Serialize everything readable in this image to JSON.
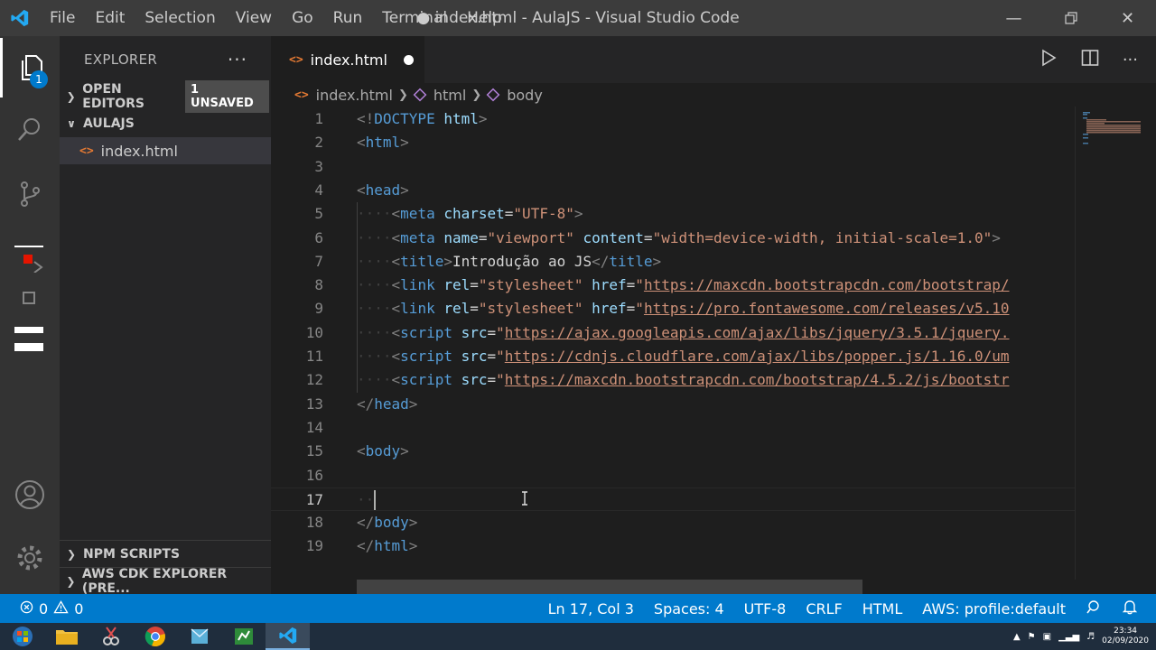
{
  "window": {
    "title": "● index.html - AulaJS - Visual Studio Code",
    "menu": [
      "File",
      "Edit",
      "Selection",
      "View",
      "Go",
      "Run",
      "Terminal",
      "Help"
    ]
  },
  "activity_bar": {
    "explorer_badge": "1",
    "icons": [
      "files-icon",
      "search-icon",
      "source-control-icon",
      "run-debug-icon",
      "extensions-icon",
      "accounts-icon",
      "gear-icon"
    ]
  },
  "sidebar": {
    "title": "EXPLORER",
    "more": "···",
    "open_editors": {
      "label": "OPEN EDITORS",
      "badge": "1 UNSAVED"
    },
    "folder": {
      "label": "AULAJS",
      "files": [
        "index.html"
      ]
    },
    "npm_scripts": "NPM SCRIPTS",
    "aws_cdk": "AWS CDK EXPLORER (PRE..."
  },
  "tabs": [
    {
      "label": "index.html",
      "dirty": true
    }
  ],
  "breadcrumb": [
    "index.html",
    "html",
    "body"
  ],
  "editor": {
    "current_line": 17,
    "line_numbers": [
      "1",
      "2",
      "3",
      "4",
      "5",
      "6",
      "7",
      "8",
      "9",
      "10",
      "11",
      "12",
      "13",
      "14",
      "15",
      "16",
      "17",
      "18",
      "19"
    ],
    "lines": [
      {
        "indent": "",
        "tokens": [
          [
            "br",
            "<!"
          ],
          [
            "tag",
            "DOCTYPE"
          ],
          [
            "tx",
            " "
          ],
          [
            "at",
            "html"
          ],
          [
            "br",
            ">"
          ]
        ]
      },
      {
        "indent": "",
        "tokens": [
          [
            "br",
            "<"
          ],
          [
            "tag",
            "html"
          ],
          [
            "br",
            ">"
          ]
        ]
      },
      {
        "indent": "",
        "tokens": []
      },
      {
        "indent": "",
        "tokens": [
          [
            "br",
            "<"
          ],
          [
            "tag",
            "head"
          ],
          [
            "br",
            ">"
          ]
        ]
      },
      {
        "indent": "····",
        "tokens": [
          [
            "br",
            "<"
          ],
          [
            "tag",
            "meta"
          ],
          [
            "tx",
            " "
          ],
          [
            "at",
            "charset"
          ],
          [
            "tx",
            "="
          ],
          [
            "st",
            "\"UTF-8\""
          ],
          [
            "br",
            ">"
          ]
        ]
      },
      {
        "indent": "····",
        "tokens": [
          [
            "br",
            "<"
          ],
          [
            "tag",
            "meta"
          ],
          [
            "tx",
            " "
          ],
          [
            "at",
            "name"
          ],
          [
            "tx",
            "="
          ],
          [
            "st",
            "\"viewport\""
          ],
          [
            "tx",
            " "
          ],
          [
            "at",
            "content"
          ],
          [
            "tx",
            "="
          ],
          [
            "st",
            "\"width=device-width, initial-scale=1.0\""
          ],
          [
            "br",
            ">"
          ]
        ]
      },
      {
        "indent": "····",
        "tokens": [
          [
            "br",
            "<"
          ],
          [
            "tag",
            "title"
          ],
          [
            "br",
            ">"
          ],
          [
            "tx",
            "Introdução ao JS"
          ],
          [
            "br",
            "</"
          ],
          [
            "tag",
            "title"
          ],
          [
            "br",
            ">"
          ]
        ]
      },
      {
        "indent": "····",
        "tokens": [
          [
            "br",
            "<"
          ],
          [
            "tag",
            "link"
          ],
          [
            "tx",
            " "
          ],
          [
            "at",
            "rel"
          ],
          [
            "tx",
            "="
          ],
          [
            "st",
            "\"stylesheet\""
          ],
          [
            "tx",
            " "
          ],
          [
            "at",
            "href"
          ],
          [
            "tx",
            "="
          ],
          [
            "st",
            "\""
          ],
          [
            "lk",
            "https://maxcdn.bootstrapcdn.com/bootstrap/"
          ]
        ]
      },
      {
        "indent": "····",
        "tokens": [
          [
            "br",
            "<"
          ],
          [
            "tag",
            "link"
          ],
          [
            "tx",
            " "
          ],
          [
            "at",
            "rel"
          ],
          [
            "tx",
            "="
          ],
          [
            "st",
            "\"stylesheet\""
          ],
          [
            "tx",
            " "
          ],
          [
            "at",
            "href"
          ],
          [
            "tx",
            "="
          ],
          [
            "st",
            "\""
          ],
          [
            "lk",
            "https://pro.fontawesome.com/releases/v5.10"
          ]
        ]
      },
      {
        "indent": "····",
        "tokens": [
          [
            "br",
            "<"
          ],
          [
            "tag",
            "script"
          ],
          [
            "tx",
            " "
          ],
          [
            "at",
            "src"
          ],
          [
            "tx",
            "="
          ],
          [
            "st",
            "\""
          ],
          [
            "lk",
            "https://ajax.googleapis.com/ajax/libs/jquery/3.5.1/jquery."
          ]
        ]
      },
      {
        "indent": "····",
        "tokens": [
          [
            "br",
            "<"
          ],
          [
            "tag",
            "script"
          ],
          [
            "tx",
            " "
          ],
          [
            "at",
            "src"
          ],
          [
            "tx",
            "="
          ],
          [
            "st",
            "\""
          ],
          [
            "lk",
            "https://cdnjs.cloudflare.com/ajax/libs/popper.js/1.16.0/um"
          ]
        ]
      },
      {
        "indent": "····",
        "tokens": [
          [
            "br",
            "<"
          ],
          [
            "tag",
            "script"
          ],
          [
            "tx",
            " "
          ],
          [
            "at",
            "src"
          ],
          [
            "tx",
            "="
          ],
          [
            "st",
            "\""
          ],
          [
            "lk",
            "https://maxcdn.bootstrapcdn.com/bootstrap/4.5.2/js/bootstr"
          ]
        ]
      },
      {
        "indent": "",
        "tokens": [
          [
            "br",
            "</"
          ],
          [
            "tag",
            "head"
          ],
          [
            "br",
            ">"
          ]
        ]
      },
      {
        "indent": "",
        "tokens": []
      },
      {
        "indent": "",
        "tokens": [
          [
            "br",
            "<"
          ],
          [
            "tag",
            "body"
          ],
          [
            "br",
            ">"
          ]
        ]
      },
      {
        "indent": "",
        "tokens": []
      },
      {
        "indent": "··",
        "tokens": [],
        "caret": true
      },
      {
        "indent": "",
        "tokens": [
          [
            "br",
            "</"
          ],
          [
            "tag",
            "body"
          ],
          [
            "br",
            ">"
          ]
        ]
      },
      {
        "indent": "",
        "tokens": [
          [
            "br",
            "</"
          ],
          [
            "tag",
            "html"
          ],
          [
            "br",
            ">"
          ]
        ]
      }
    ]
  },
  "status_bar": {
    "errors": "0",
    "warnings": "0",
    "position": "Ln 17, Col 3",
    "spaces": "Spaces: 4",
    "encoding": "UTF-8",
    "eol": "CRLF",
    "language": "HTML",
    "aws": "AWS: profile:default"
  },
  "taskbar": {
    "time": "23:34",
    "date": "02/09/2020"
  },
  "colors": {
    "accent": "#007acc",
    "tag": "#569cd6",
    "attr": "#9cdcfe",
    "string": "#ce9178"
  }
}
